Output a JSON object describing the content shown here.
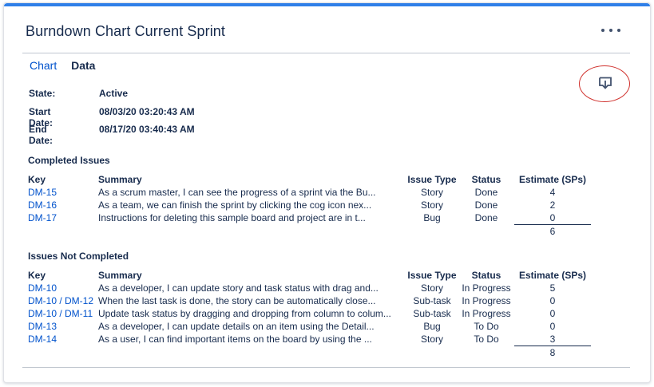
{
  "header": {
    "title": "Burndown Chart Current Sprint",
    "more_icon": "more-horizontal-icon"
  },
  "tabs": [
    {
      "label": "Chart"
    },
    {
      "label": "Data"
    }
  ],
  "export_icon": "download-tray-icon",
  "meta": {
    "state_label": "State:",
    "state_value": "Active",
    "start_label": "Start Date:",
    "start_value": "08/03/20 03:20:43 AM",
    "end_label": "End Date:",
    "end_value": "08/17/20 03:40:43 AM"
  },
  "columns": {
    "key": "Key",
    "summary": "Summary",
    "type": "Issue Type",
    "status": "Status",
    "estimate": "Estimate (SPs)"
  },
  "completed": {
    "title": "Completed Issues",
    "rows": [
      {
        "key": "DM-15",
        "summary": "As a scrum master, I can see the progress of a sprint via the Bu...",
        "type": "Story",
        "status": "Done",
        "estimate": "4"
      },
      {
        "key": "DM-16",
        "summary": "As a team, we can finish the sprint by clicking the cog icon nex...",
        "type": "Story",
        "status": "Done",
        "estimate": "2"
      },
      {
        "key": "DM-17",
        "summary": "Instructions for deleting this sample board and project are in t...",
        "type": "Bug",
        "status": "Done",
        "estimate": "0"
      }
    ],
    "total": "6"
  },
  "not_completed": {
    "title": "Issues Not Completed",
    "rows": [
      {
        "key": "DM-10",
        "summary": "As a developer, I can update story and task status with drag and...",
        "type": "Story",
        "status": "In Progress",
        "estimate": "5"
      },
      {
        "key": "DM-10 / DM-12",
        "summary": "When the last task is done, the story can be automatically close...",
        "type": "Sub-task",
        "status": "In Progress",
        "estimate": "0"
      },
      {
        "key": "DM-10 / DM-11",
        "summary": "Update task status by dragging and dropping from column to colum...",
        "type": "Sub-task",
        "status": "In Progress",
        "estimate": "0"
      },
      {
        "key": "DM-13",
        "summary": "As a developer, I can update details on an item using the Detail...",
        "type": "Bug",
        "status": "To Do",
        "estimate": "0"
      },
      {
        "key": "DM-14",
        "summary": "As a user, I can find important items on the board by using the ...",
        "type": "Story",
        "status": "To Do",
        "estimate": "3"
      }
    ],
    "total": "8"
  },
  "colors": {
    "accent_bar": "#2f7fe8",
    "link": "#0052cc",
    "text": "#172b4d",
    "highlight_circle": "#d0312d"
  }
}
